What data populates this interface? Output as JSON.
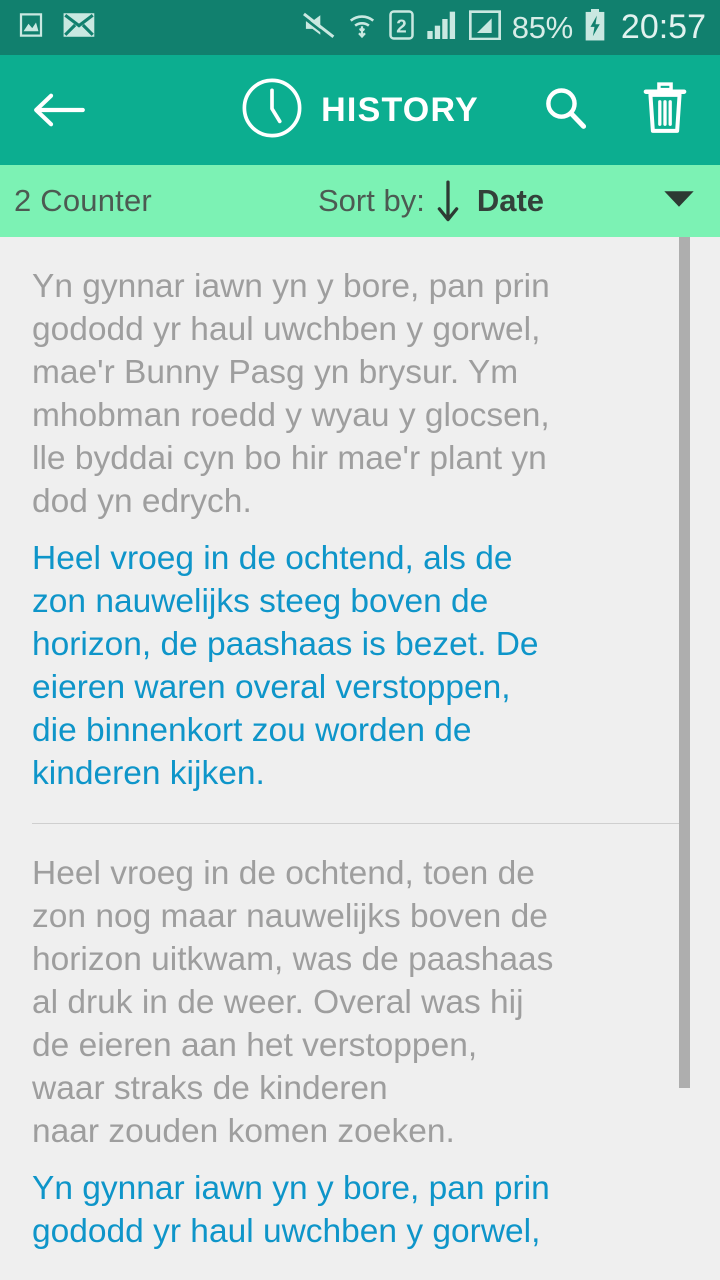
{
  "status_bar": {
    "icons_left": [
      "image-icon",
      "envelope-icon"
    ],
    "icons_right": [
      "mute-icon",
      "wifi-icon",
      "sim2-icon",
      "signal-icon",
      "signal-alt-icon"
    ],
    "battery_percent": "85%",
    "battery_icon": "battery-charging-icon",
    "time": "20:57"
  },
  "app_bar": {
    "back_icon": "arrow-left-icon",
    "title_icon": "clock-icon",
    "title": "HISTORY",
    "search_icon": "search-icon",
    "delete_icon": "trash-icon"
  },
  "sort_bar": {
    "counter": "2 Counter",
    "sort_label": "Sort by:",
    "sort_direction_icon": "arrow-down-icon",
    "sort_value": "Date",
    "caret_icon": "chevron-down-icon"
  },
  "colors": {
    "status_bar": "#11806e",
    "app_bar": "#0cae90",
    "sort_bar": "#7cf2b4",
    "list_background": "#efefef",
    "source_text": "#9e9e9e",
    "translated_text": "#0e95c9",
    "divider": "#cfcfcf",
    "scrollbar": "#aeaeae"
  },
  "list": {
    "items": [
      {
        "source_text": "Yn gynnar iawn yn y bore, pan prin\ngododd yr haul uwchben y gorwel,\nmae'r Bunny Pasg yn brysur. Ym\nmhobman roedd y wyau y glocsen,\nlle byddai cyn bo hir mae'r plant yn\ndod yn edrych.",
        "translated_text": "Heel vroeg in de ochtend, als de\nzon nauwelijks steeg boven de\nhorizon, de paashaas is bezet. De\neieren waren overal verstoppen,\ndie binnenkort zou worden de\nkinderen kijken."
      },
      {
        "source_text": "Heel vroeg in de ochtend, toen de\nzon nog maar nauwelijks boven de\nhorizon uitkwam, was de paashaas\nal druk in de weer. Overal was hij\nde eieren aan het verstoppen,\nwaar straks de kinderen\nnaar zouden komen zoeken.",
        "translated_text": "Yn gynnar iawn yn y bore, pan prin\ngododd yr haul uwchben y gorwel,"
      }
    ]
  }
}
